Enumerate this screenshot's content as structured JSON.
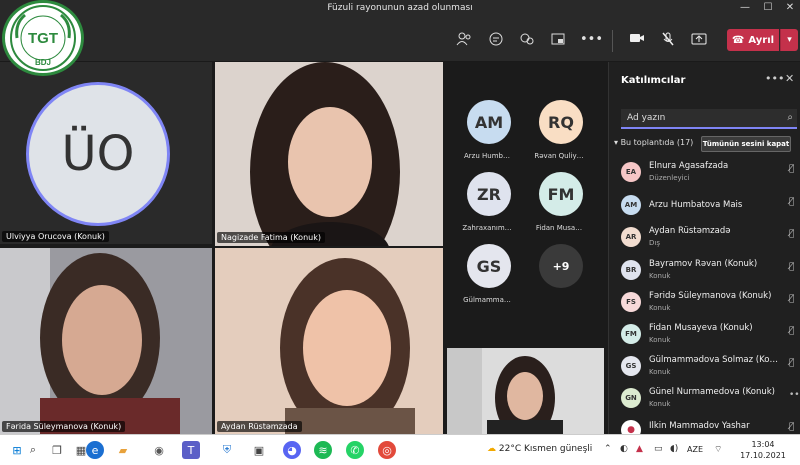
{
  "window": {
    "title": "Füzuli rayonunun azad olunması"
  },
  "logo": {
    "text_top": "BAKI DÖVLƏT UNİVERSİTETİ",
    "text_mid": "TGT",
    "text_bottom": "BDJ"
  },
  "toolbar": {
    "leave_label": "Ayrıl"
  },
  "tiles": {
    "main_avatar_initials": "ÜO",
    "main_name": "Ulviyya Orucova (Konuk)",
    "video1_name": "Nagizade Fatima (Konuk)",
    "video2_name": "Fərida Süleymanova (Konuk)",
    "video3_name": "Aydan Rüstəmzada"
  },
  "mini_tiles": [
    {
      "initials": "AM",
      "label": "Arzu Humb…",
      "color": "#c7dcf0"
    },
    {
      "initials": "RQ",
      "label": "Rəvan Quliy…",
      "color": "#f9dec4"
    },
    {
      "initials": "ZR",
      "label": "Zahraxanım…",
      "color": "#dfe3ee"
    },
    {
      "initials": "FM",
      "label": "Fidan Musa…",
      "color": "#d4ece8"
    },
    {
      "initials": "GS",
      "label": "Gülmamma…",
      "color": "#e4e6ee"
    },
    {
      "initials": "+9",
      "label": "",
      "color": "#3a3a3a"
    }
  ],
  "panel": {
    "title": "Katılımcılar",
    "search_placeholder": "Ad yazın",
    "section_label": "Bu toplantıda (17)",
    "mute_all_label": "Tümünün sesini kapat",
    "participants": [
      {
        "initials": "EA",
        "name": "Elnura Agasafzada",
        "role": "Düzenleyici",
        "color": "#f6c6c6"
      },
      {
        "initials": "AM",
        "name": "Arzu Humbatova Mais",
        "role": "",
        "color": "#c7dcf0"
      },
      {
        "initials": "AR",
        "name": "Aydan Rüstəmzadə",
        "role": "Dış",
        "color": "#f2ddd0"
      },
      {
        "initials": "BR",
        "name": "Bayramov Rəvan (Konuk)",
        "role": "Konuk",
        "color": "#dfe3ee"
      },
      {
        "initials": "FS",
        "name": "Fəridə Süleymanova (Konuk)",
        "role": "Konuk",
        "color": "#f7d9d9"
      },
      {
        "initials": "FM",
        "name": "Fidan Musayeva (Konuk)",
        "role": "Konuk",
        "color": "#d4ece8"
      },
      {
        "initials": "GS",
        "name": "Gülmammədova Solmaz (Kon…",
        "role": "Konuk",
        "color": "#e4e6ee"
      },
      {
        "initials": "GN",
        "name": "Günel Nurmamedova (Konuk)",
        "role": "Konuk",
        "color": "#dcebd0"
      },
      {
        "initials": "",
        "name": "Ilkin Mammadov Yashar",
        "role": "",
        "color": "#ffffff"
      }
    ]
  },
  "taskbar": {
    "weather": "22°C  Kısmen güneşli",
    "lang": "AZE",
    "time": "13:04",
    "date": "17.10.2021"
  }
}
